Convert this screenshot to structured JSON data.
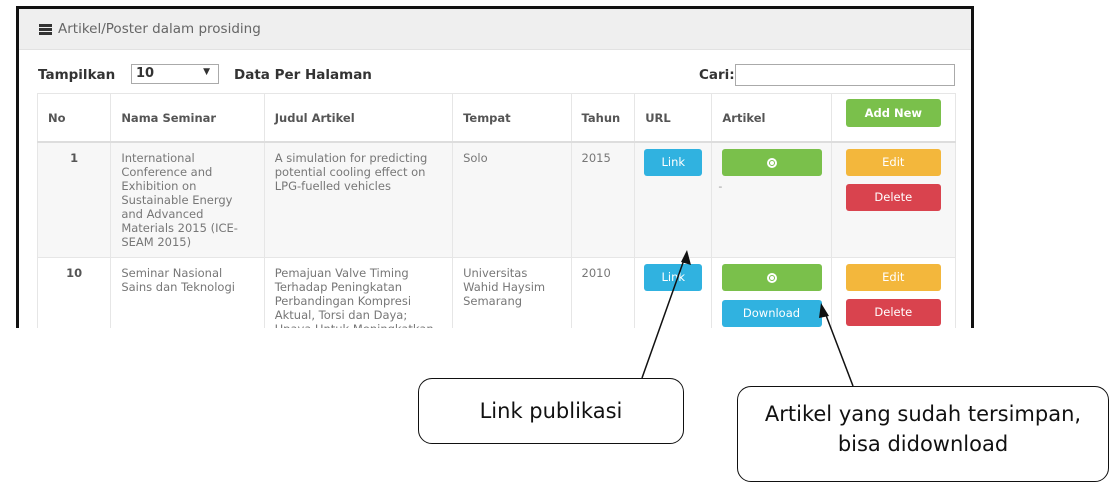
{
  "panel": {
    "title": "Artikel/Poster dalam prosiding",
    "icon": "list-icon"
  },
  "controls": {
    "show_label": "Tampilkan",
    "page_size": "10",
    "per_page_label": "Data Per Halaman",
    "search_label": "Cari:",
    "search_value": ""
  },
  "table": {
    "columns": [
      "No",
      "Nama Seminar",
      "Judul Artikel",
      "Tempat",
      "Tahun",
      "URL",
      "Artikel"
    ],
    "add_label": "Add New",
    "rows": [
      {
        "no": "1",
        "seminar": "International Conference and Exhibition on Sustainable Energy and Advanced Materials 2015 (ICE-SEAM 2015)",
        "judul": "A simulation for predicting potential cooling effect on LPG-fuelled vehicles",
        "tempat": "Solo",
        "tahun": "2015",
        "link_label": "Link",
        "artikel_note": "-",
        "edit_label": "Edit",
        "delete_label": "Delete"
      },
      {
        "no": "10",
        "seminar": "Seminar Nasional Sains dan Teknologi",
        "judul": "Pemajuan Valve Timing Terhadap Peningkatan Perbandingan Kompresi Aktual, Torsi dan Daya; Upaya Untuk Meningkatkan Unjuk Kerja Mesin",
        "tempat": "Universitas Wahid Haysim Semarang",
        "tahun": "2010",
        "link_label": "Link",
        "download_label": "Download",
        "edit_label": "Edit",
        "delete_label": "Delete"
      }
    ]
  },
  "callouts": {
    "link": "Link publikasi",
    "download_line1": "Artikel yang sudah tersimpan,",
    "download_line2": "bisa didownload"
  },
  "colors": {
    "info": "#30b2e0",
    "success": "#7ac04b",
    "warning": "#f3b73c",
    "danger": "#d9434e"
  }
}
